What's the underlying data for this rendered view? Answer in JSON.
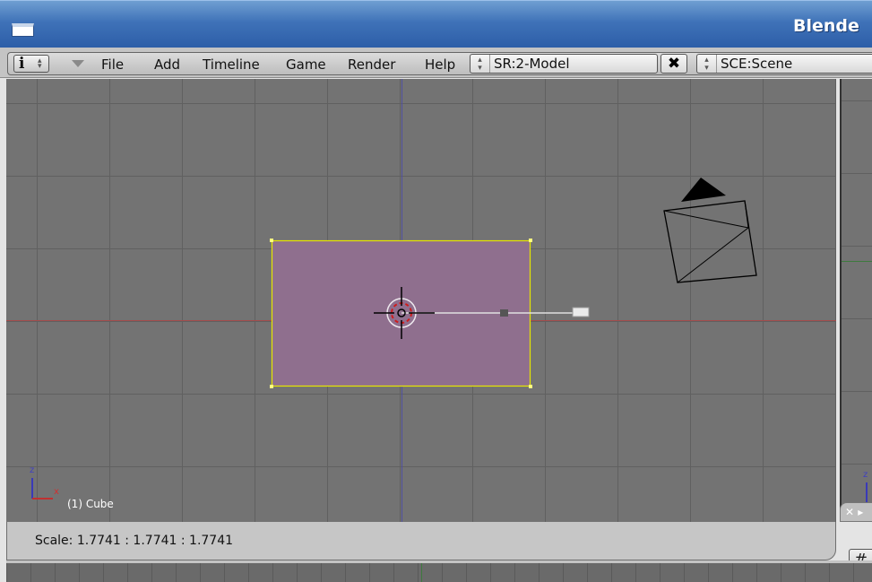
{
  "window": {
    "title": "Blende"
  },
  "header": {
    "info_icon": "info-icon",
    "menus": [
      "File",
      "Add",
      "Timeline",
      "Game",
      "Render",
      "Help"
    ],
    "screen_selector": "SR:2-Model",
    "scene_selector": "SCE:Scene",
    "delete_label": "✖"
  },
  "viewport": {
    "object_label": "(1) Cube",
    "axis_z": "z",
    "axis_x": "x",
    "colors": {
      "background": "#737373",
      "grid": "#606060",
      "selected_face": "#8f6f8e",
      "selected_edge": "#e6e600",
      "x_axis": "#a34c4c",
      "z_axis": "#4f4f9e"
    }
  },
  "right_viewport": {
    "axis_z": "z",
    "close_label": "✕ ▸",
    "grid_icon": "grid-icon"
  },
  "status": {
    "text": "Scale: 1.7741 : 1.7741 : 1.7741"
  }
}
